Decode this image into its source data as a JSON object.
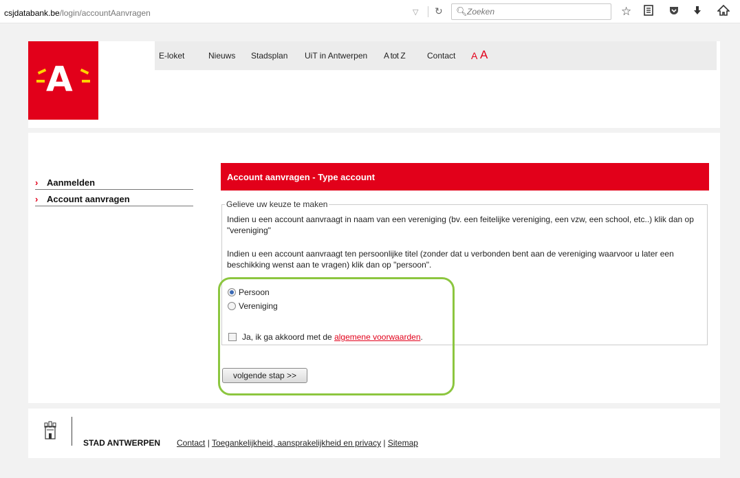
{
  "browser": {
    "url_host": "csjdatabank.be",
    "url_path": "/login/accountAanvragen",
    "search_placeholder": "Zoeken"
  },
  "header": {
    "logo_letter": "A",
    "nav": [
      "E-loket",
      "Nieuws",
      "Stadsplan",
      "UiT in Antwerpen",
      "A tot Z",
      "Contact"
    ],
    "font_small": "A",
    "font_large": "A"
  },
  "sidebar": {
    "items": [
      {
        "label": "Aanmelden"
      },
      {
        "label": "Account aanvragen"
      }
    ]
  },
  "panel": {
    "title": "Account aanvragen - Type account",
    "legend": "Gelieve uw keuze te maken",
    "para1": "Indien u een account aanvraagt in naam van een vereniging (bv. een feitelijke vereniging, een vzw, een school, etc..) klik dan op \"vereniging\"",
    "para2": "Indien u een account aanvraagt ten persoonlijke titel (zonder dat u verbonden bent aan de vereniging waarvoor u later een beschikking wenst aan te vragen) klik dan op \"persoon\".",
    "options": [
      {
        "label": "Persoon",
        "selected": true
      },
      {
        "label": "Vereniging",
        "selected": false
      }
    ],
    "agree_prefix": "Ja, ik ga akkoord met de ",
    "agree_link": "algemene voorwaarden",
    "agree_suffix": ".",
    "agree_checked": false,
    "next_button": "volgende stap >>"
  },
  "footer": {
    "brand": "STAD ANTWERPEN",
    "links": [
      "Contact",
      "Toegankelijkheid, aansprakelijkheid en privacy",
      "Sitemap"
    ],
    "separator": " | "
  },
  "colors": {
    "brand_red": "#e2001a",
    "highlight_green": "#8cc63f"
  }
}
